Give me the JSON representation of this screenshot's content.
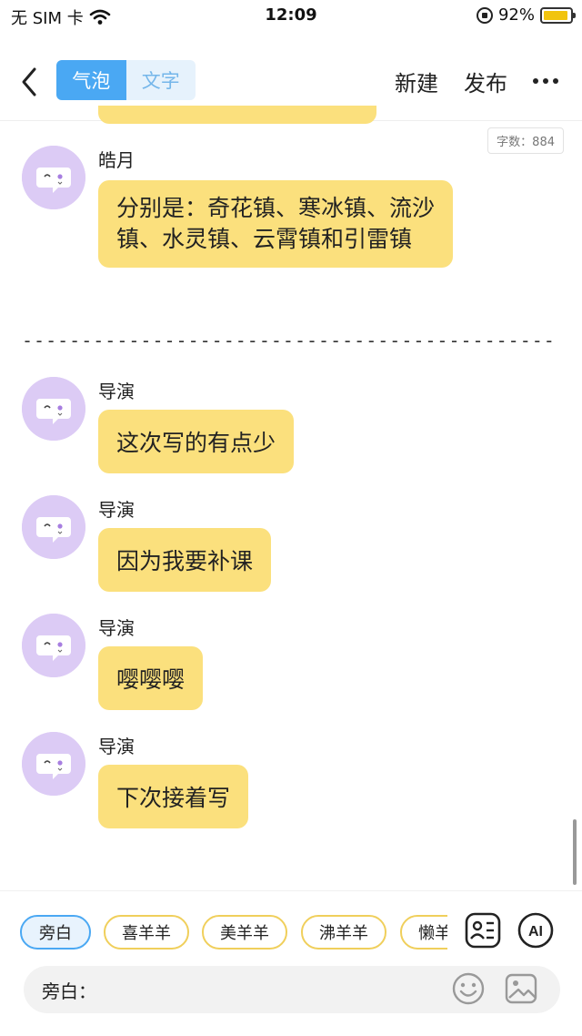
{
  "status_bar": {
    "carrier": "无 SIM 卡",
    "time": "12:09",
    "battery_percent": "92%",
    "battery_level": 0.92,
    "icons": [
      "wifi-icon",
      "orientation-lock-icon",
      "battery-icon"
    ]
  },
  "nav": {
    "back_icon": "chevron-left-icon",
    "tabs": [
      {
        "label": "气泡",
        "active": true
      },
      {
        "label": "文字",
        "active": false
      }
    ],
    "new_label": "新建",
    "publish_label": "发布",
    "more_icon": "ellipsis-icon"
  },
  "word_count": "字数：884",
  "messages": [
    {
      "speaker": "皓月",
      "lines": [
        "分别是：奇花镇、寒冰镇、流沙",
        "镇、水灵镇、云霄镇和引雷镇"
      ]
    },
    {
      "speaker": "导演",
      "text": "这次写的有点少"
    },
    {
      "speaker": "导演",
      "text": "因为我要补课"
    },
    {
      "speaker": "导演",
      "text": "嘤嘤嘤"
    },
    {
      "speaker": "导演",
      "text": "下次接着写"
    }
  ],
  "separator": "---------------------------------------------------",
  "roles": [
    {
      "label": "旁白",
      "active": true
    },
    {
      "label": "喜羊羊",
      "active": false
    },
    {
      "label": "美羊羊",
      "active": false
    },
    {
      "label": "沸羊羊",
      "active": false
    },
    {
      "label": "懒羊羊",
      "active": false
    }
  ],
  "tools": {
    "role_card_icon": "role-card-icon",
    "ai_label": "AI"
  },
  "composer": {
    "speaker_label": "旁白：",
    "value": "",
    "emoji_icon": "emoji-icon",
    "image_icon": "image-icon"
  },
  "colors": {
    "accent": "#4aa8f3",
    "bubble": "#fbe07d",
    "avatar": "#dccbf5",
    "chip_border": "#f0cf5b"
  }
}
